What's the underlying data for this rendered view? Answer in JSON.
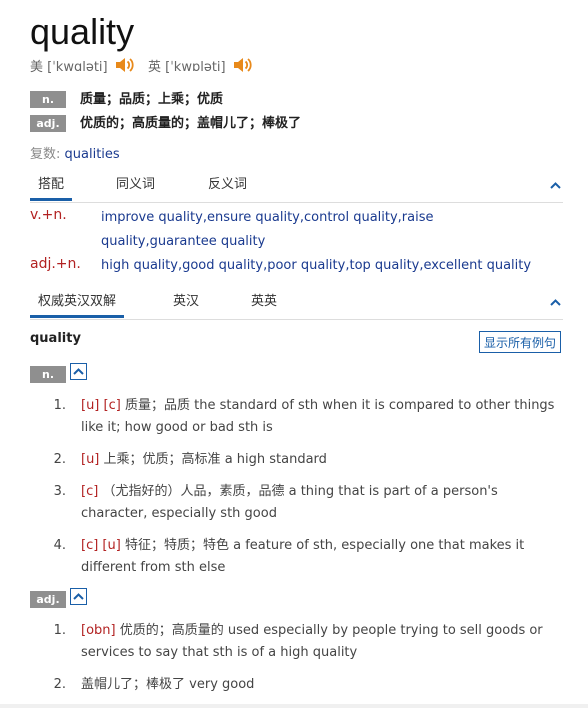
{
  "headword": "quality",
  "pron": {
    "us": {
      "label": "美",
      "ipa": "[ˈkwɑləti]"
    },
    "uk": {
      "label": "英",
      "ipa": "[ˈkwɒləti]"
    }
  },
  "basic_defs": [
    {
      "pos": "n.",
      "text": "质量；品质；上乘；优质"
    },
    {
      "pos": "adj.",
      "text": "优质的；高质量的；盖帽儿了；棒极了"
    }
  ],
  "plural": {
    "label": "复数:",
    "value": "qualities"
  },
  "tabs1": [
    "搭配",
    "同义词",
    "反义词"
  ],
  "collocations": [
    {
      "label": "v.+n.",
      "text": "improve quality,ensure quality,control quality,raise quality,guarantee quality"
    },
    {
      "label": "adj.+n.",
      "text": "high quality,good quality,poor quality,top quality,excellent quality"
    }
  ],
  "tabs2": [
    "权威英汉双解",
    "英汉",
    "英英"
  ],
  "entry_head": "quality",
  "show_all_label": "显示所有例句",
  "n_tag": "n.",
  "adj_tag": "adj.",
  "n_senses": [
    {
      "num": "1.",
      "tag": "[u] [c]",
      "cn": "质量；品质",
      "en": "the standard of sth when it is compared to other things like it; how good or bad sth is"
    },
    {
      "num": "2.",
      "tag": "[u]",
      "cn": "上乘；优质；高标准",
      "en": "a high standard"
    },
    {
      "num": "3.",
      "tag": "[c]",
      "cn": "（尤指好的）人品，素质，品德",
      "en": "a thing that is part of a person's character, especially sth good"
    },
    {
      "num": "4.",
      "tag": "[c] [u]",
      "cn": "特征；特质；特色",
      "en": "a feature of sth, especially one that makes it different from sth else"
    }
  ],
  "adj_senses": [
    {
      "num": "1.",
      "tag": "[obn]",
      "cn": "优质的；高质量的",
      "en": "used especially by people trying to sell goods or services to say that sth is of a high quality"
    },
    {
      "num": "2.",
      "tag": "",
      "cn": "盖帽儿了；棒极了",
      "en": "very good"
    }
  ],
  "colors": {
    "accent": "#1a5fa8",
    "label_red": "#b22222",
    "speaker": "#e8891a",
    "tag_bg": "#8f8f8f"
  }
}
